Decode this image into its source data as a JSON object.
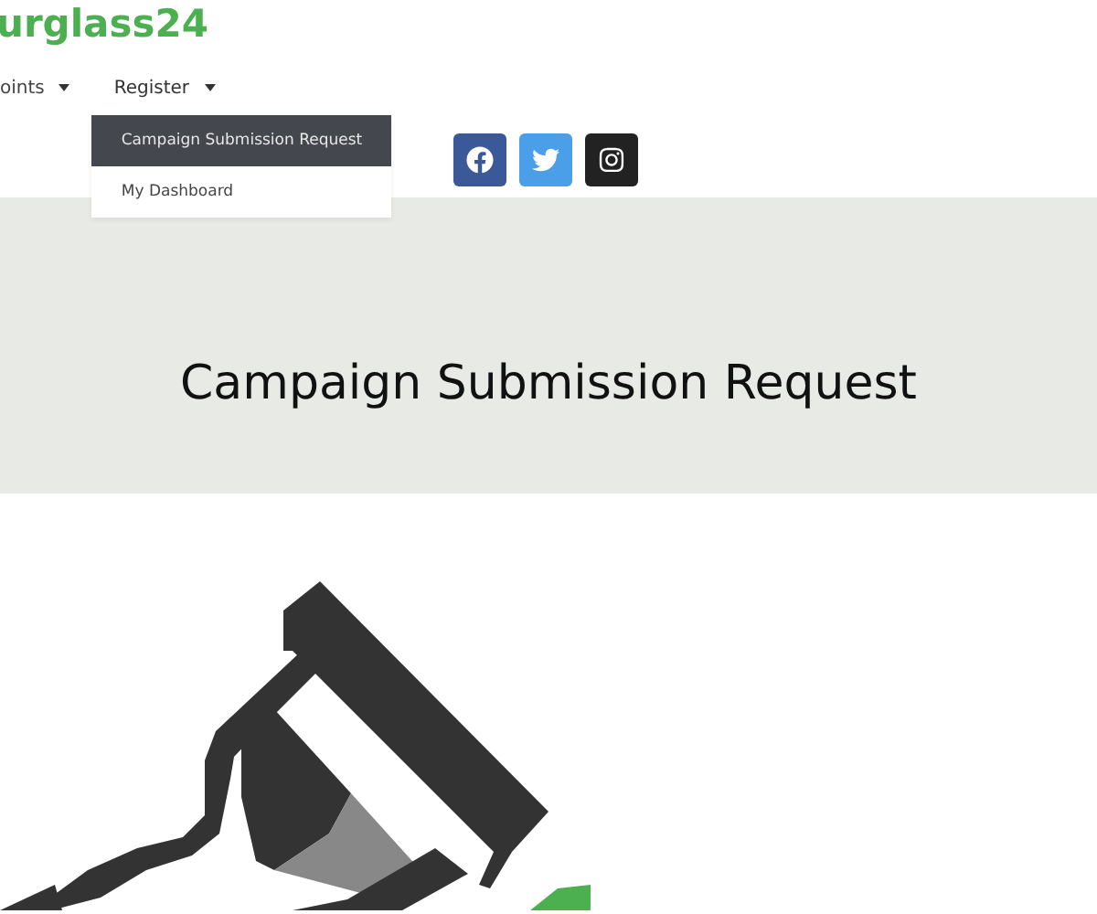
{
  "logo": {
    "text": "urglass24"
  },
  "nav": [
    {
      "label": "oints",
      "selected": false
    },
    {
      "label": "Register",
      "selected": true
    }
  ],
  "dropdown": [
    {
      "label": "Campaign Submission Request",
      "selected": true
    },
    {
      "label": "My Dashboard",
      "selected": false
    }
  ],
  "social": [
    {
      "kind": "facebook",
      "color": "#3b5998"
    },
    {
      "kind": "twitter",
      "color": "#4a9fe8"
    },
    {
      "kind": "instagram",
      "color": "#222222"
    }
  ],
  "hero": {
    "title": "Campaign Submission Request"
  }
}
